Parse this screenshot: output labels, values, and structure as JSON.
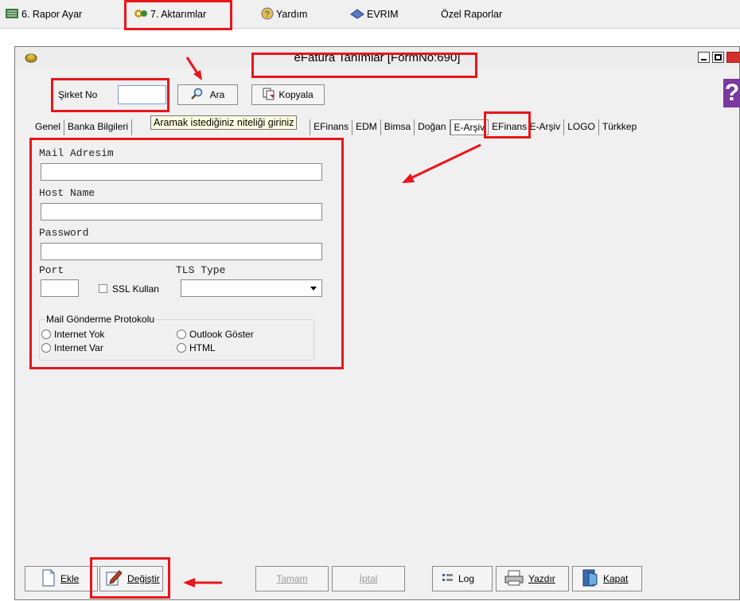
{
  "menubar": {
    "items": [
      {
        "label": "6.  Rapor Ayar",
        "icon": "report-icon"
      },
      {
        "label": "7.  Aktarımlar",
        "icon": "transfer-icon"
      },
      {
        "label": "Yardım",
        "icon": "help-icon"
      },
      {
        "label": "EVRIM",
        "icon": "evrim-icon"
      },
      {
        "label": "Özel Raporlar",
        "icon": ""
      }
    ]
  },
  "window": {
    "title": "eFatura Tanımlar [FormNo:690]",
    "help_glyph": "?"
  },
  "search": {
    "company_label": "Şirket No",
    "company_value": "",
    "search_button": "Ara",
    "copy_button": "Kopyala",
    "tooltip": "Aramak istediğiniz niteliği giriniz"
  },
  "tabs": [
    "Genel",
    "Banka Bilgileri",
    "",
    "EFinans",
    "EDM",
    "Bimsa",
    "Doğan",
    "E-Arşiv",
    "EFinans E-Arşiv",
    "LOGO",
    "Türkkep"
  ],
  "active_tab": "E-Arşiv",
  "form": {
    "mail_label": "Mail Adresim",
    "mail_value": "",
    "host_label": "Host Name",
    "host_value": "",
    "password_label": "Password",
    "password_value": "",
    "port_label": "Port",
    "port_value": "",
    "ssl_label": "SSL Kullan",
    "ssl_checked": false,
    "tls_label": "TLS Type",
    "tls_value": "",
    "protocol_group": "Mail Gönderme Protokolu",
    "radios": [
      {
        "label": "Internet Yok",
        "checked": false
      },
      {
        "label": "Outlook Göster",
        "checked": false
      },
      {
        "label": "Internet Var",
        "checked": false
      },
      {
        "label": "HTML",
        "checked": false
      }
    ]
  },
  "bottom": {
    "add": "Ekle",
    "edit": "Değiştir",
    "ok": "Tamam",
    "cancel": "İptal",
    "log": "Log",
    "print": "Yazdır",
    "close": "Kapat"
  },
  "colors": {
    "annotation": "#e8161b",
    "window_bg": "#f0f0f0",
    "tooltip_bg": "#ffffe1"
  }
}
